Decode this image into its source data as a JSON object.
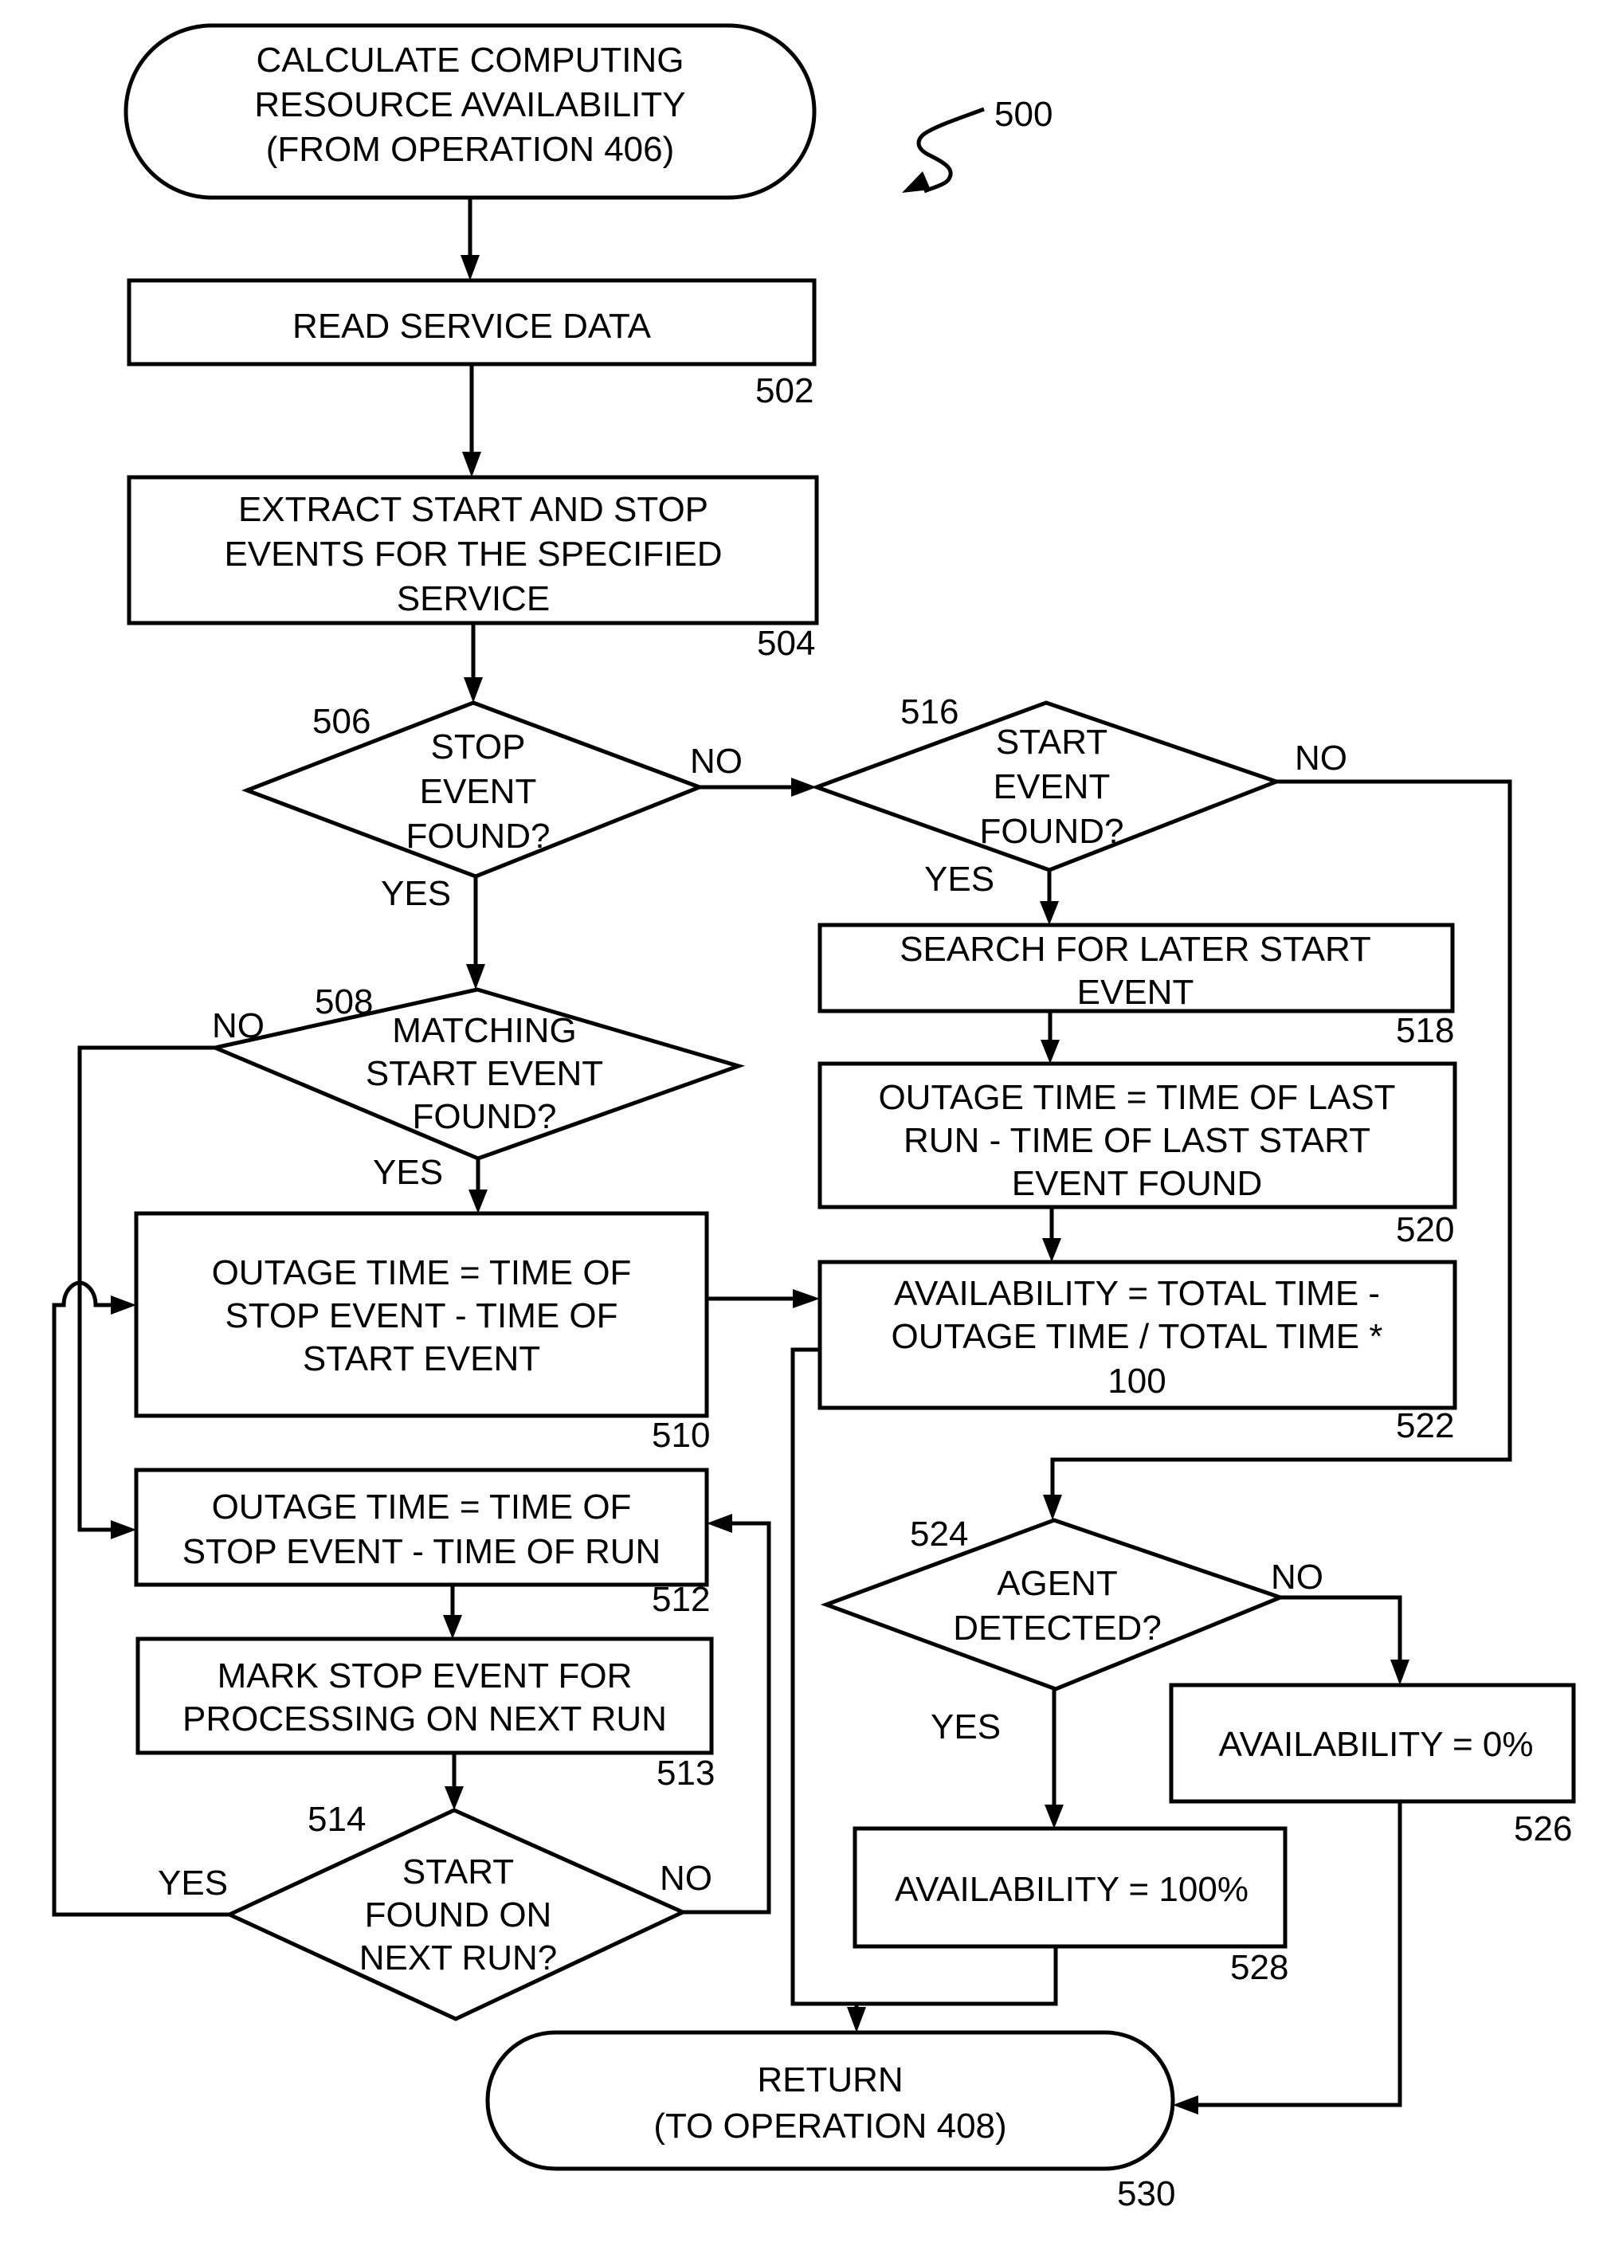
{
  "figure": {
    "ref": "500"
  },
  "nodes": {
    "start": {
      "ref": "",
      "type": "terminator",
      "lines": [
        "CALCULATE COMPUTING",
        "RESOURCE AVAILABILITY",
        "(FROM OPERATION 406)"
      ]
    },
    "n502": {
      "ref": "502",
      "type": "process",
      "lines": [
        "READ SERVICE DATA"
      ]
    },
    "n504": {
      "ref": "504",
      "type": "process",
      "lines": [
        "EXTRACT START AND STOP",
        "EVENTS FOR THE SPECIFIED",
        "SERVICE"
      ]
    },
    "n506": {
      "ref": "506",
      "type": "decision",
      "lines": [
        "STOP",
        "EVENT",
        "FOUND?"
      ]
    },
    "n508": {
      "ref": "508",
      "type": "decision",
      "lines": [
        "MATCHING",
        "START EVENT",
        "FOUND?"
      ]
    },
    "n510": {
      "ref": "510",
      "type": "process",
      "lines": [
        "OUTAGE TIME = TIME OF",
        "STOP EVENT - TIME OF",
        "START EVENT"
      ]
    },
    "n512": {
      "ref": "512",
      "type": "process",
      "lines": [
        "OUTAGE TIME = TIME OF",
        "STOP EVENT - TIME OF RUN"
      ]
    },
    "n513": {
      "ref": "513",
      "type": "process",
      "lines": [
        "MARK STOP EVENT FOR",
        "PROCESSING ON NEXT RUN"
      ]
    },
    "n514": {
      "ref": "514",
      "type": "decision",
      "lines": [
        "START",
        "FOUND ON",
        "NEXT RUN?"
      ]
    },
    "n516": {
      "ref": "516",
      "type": "decision",
      "lines": [
        "START",
        "EVENT",
        "FOUND?"
      ]
    },
    "n518": {
      "ref": "518",
      "type": "process",
      "lines": [
        "SEARCH FOR LATER START",
        "EVENT"
      ]
    },
    "n520": {
      "ref": "520",
      "type": "process",
      "lines": [
        "OUTAGE TIME = TIME OF LAST",
        "RUN - TIME OF LAST START",
        "EVENT FOUND"
      ]
    },
    "n522": {
      "ref": "522",
      "type": "process",
      "lines": [
        "AVAILABILITY = TOTAL TIME -",
        "OUTAGE TIME / TOTAL TIME *",
        "100"
      ]
    },
    "n524": {
      "ref": "524",
      "type": "decision",
      "lines": [
        "AGENT",
        "DETECTED?"
      ]
    },
    "n526": {
      "ref": "526",
      "type": "process",
      "lines": [
        "AVAILABILITY = 0%"
      ]
    },
    "n528": {
      "ref": "528",
      "type": "process",
      "lines": [
        "AVAILABILITY = 100%"
      ]
    },
    "end": {
      "ref": "530",
      "type": "terminator",
      "lines": [
        "RETURN",
        "(TO OPERATION 408)"
      ]
    }
  },
  "branches": {
    "b506_no": "NO",
    "b506_yes": "YES",
    "b508_no": "NO",
    "b508_yes": "YES",
    "b514_yes": "YES",
    "b514_no": "NO",
    "b516_no": "NO",
    "b516_yes": "YES",
    "b524_no": "NO",
    "b524_yes": "YES"
  },
  "edges": [
    {
      "from": "start",
      "to": "n502"
    },
    {
      "from": "n502",
      "to": "n504"
    },
    {
      "from": "n504",
      "to": "n506"
    },
    {
      "from": "n506",
      "to": "n508",
      "label": "YES"
    },
    {
      "from": "n506",
      "to": "n516",
      "label": "NO"
    },
    {
      "from": "n508",
      "to": "n510",
      "label": "YES"
    },
    {
      "from": "n508",
      "to": "n512",
      "label": "NO"
    },
    {
      "from": "n510",
      "to": "n522"
    },
    {
      "from": "n512",
      "to": "n513"
    },
    {
      "from": "n513",
      "to": "n514"
    },
    {
      "from": "n514",
      "to": "n510",
      "label": "YES"
    },
    {
      "from": "n514",
      "to": "n512",
      "label": "NO"
    },
    {
      "from": "n516",
      "to": "n518",
      "label": "YES"
    },
    {
      "from": "n516",
      "to": "n524",
      "label": "NO"
    },
    {
      "from": "n518",
      "to": "n520"
    },
    {
      "from": "n520",
      "to": "n522"
    },
    {
      "from": "n522",
      "to": "end"
    },
    {
      "from": "n524",
      "to": "n528",
      "label": "YES"
    },
    {
      "from": "n524",
      "to": "n526",
      "label": "NO"
    },
    {
      "from": "n528",
      "to": "end"
    },
    {
      "from": "n526",
      "to": "end"
    }
  ]
}
